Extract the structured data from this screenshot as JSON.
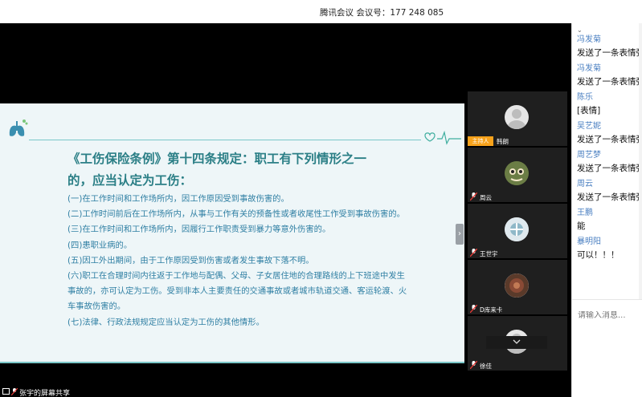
{
  "window": {
    "title": "腾讯会议 会议号：177 248 085"
  },
  "slide": {
    "heading": "《工伤保险条例》第十四条规定：职工有下列情形之一的，应当认定为工伤：",
    "items": [
      "(一)在工作时间和工作场所内，因工作原因受到事故伤害的。",
      "(二)工作时间前后在工作场所内，从事与工作有关的预备性或者收尾性工作受到事故伤害的。",
      "(三)在工作时间和工作场所内，因履行工作职责受到暴力等意外伤害的。",
      "(四)患职业病的。",
      "(五)因工外出期间，由于工作原因受到伤害或者发生事故下落不明。",
      "(六)职工在合理时间内往返于工作地与配偶、父母、子女居住地的合理路线的上下班途中发生事故的，亦可认定为工伤。受到非本人主要责任的交通事故或者城市轨道交通、客运轮渡、火车事故伤害的。",
      "(七)法律、行政法规规定应当认定为工伤的其他情形。"
    ]
  },
  "participants": {
    "host_badge": "主持人",
    "list": [
      {
        "name": "韩朗",
        "avatar": "default-avatar"
      },
      {
        "name": "周云",
        "avatar": "anime-avatar"
      },
      {
        "name": "王世宇",
        "avatar": "photo-avatar"
      },
      {
        "name": "D库来卡",
        "avatar": "photo-avatar"
      },
      {
        "name": "徐佳",
        "avatar": "default-avatar"
      }
    ],
    "expand_icon": "chevron-down-icon"
  },
  "status_bar": {
    "label": "张宇的屏幕共享"
  },
  "chat": {
    "messages": [
      {
        "sender": "冯发菊",
        "text": "发送了一条表情弹"
      },
      {
        "sender": "冯发菊",
        "text": "发送了一条表情弹"
      },
      {
        "sender": "陈乐",
        "text": "[表情]"
      },
      {
        "sender": "吴艺妮",
        "text": "发送了一条表情弹"
      },
      {
        "sender": "周艺梦",
        "text": "发送了一条表情弹"
      },
      {
        "sender": "周云",
        "text": "发送了一条表情弹"
      },
      {
        "sender": "王鹏",
        "text": "能"
      },
      {
        "sender": "暴明阳",
        "text": "可以！！！"
      }
    ],
    "input_placeholder": "请输入消息..."
  },
  "colors": {
    "accent_teal": "#2b7f86",
    "body_blue": "#2f7fa3",
    "host_orange": "#f7a21b",
    "sender_blue": "#4a7fc1"
  }
}
